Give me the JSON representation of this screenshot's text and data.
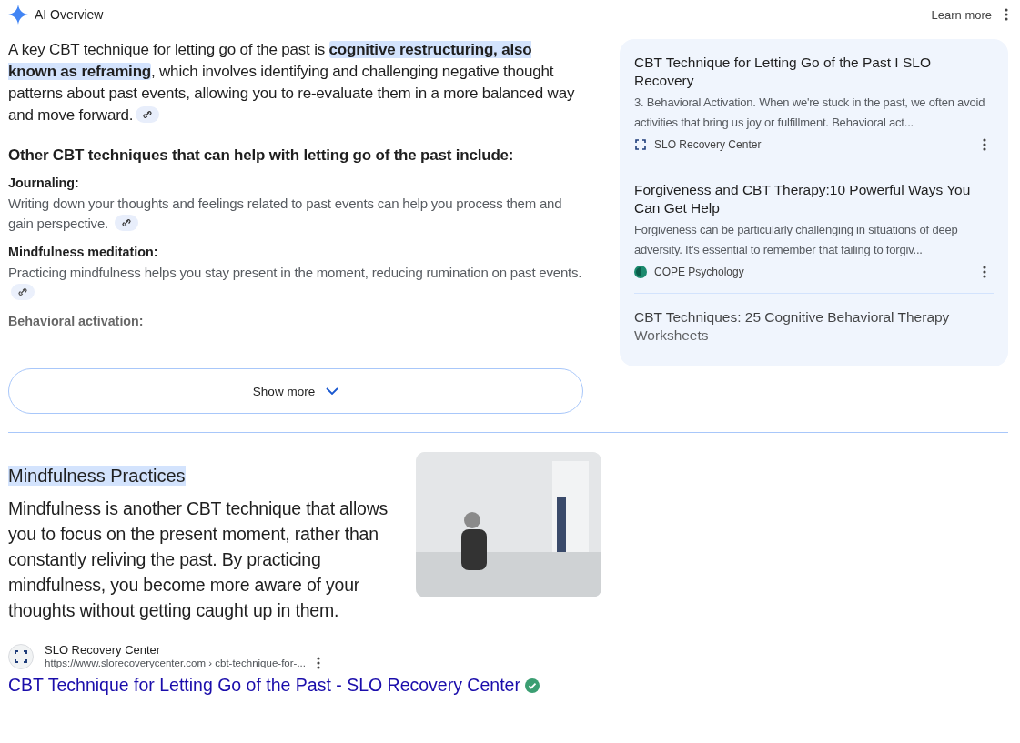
{
  "header": {
    "title": "AI Overview",
    "learn_more": "Learn more"
  },
  "overview": {
    "intro": [
      {
        "text": "A key CBT technique for letting go of the past is ",
        "highlighted": false
      },
      {
        "text": "cognitive restructuring, also known as reframing",
        "highlighted": true
      },
      {
        "text": ", which involves identifying and challenging negative thought patterns about past events, allowing you to re-evaluate them in a more balanced way and move forward.",
        "highlighted": false
      }
    ],
    "subheading": "Other CBT techniques that can help with letting go of the past include:",
    "techniques": [
      {
        "title": "Journaling:",
        "text": "Writing down your thoughts and feelings related to past events can help you process them and gain perspective."
      },
      {
        "title": "Mindfulness meditation:",
        "text": "Practicing mindfulness helps you stay present in the moment, reducing rumination on past events."
      },
      {
        "title": "Behavioral activation:"
      }
    ],
    "show_more": "Show more"
  },
  "sources": [
    {
      "title": "CBT Technique for Letting Go of the Past I SLO Recovery",
      "snippet": "3. Behavioral Activation. When we're stuck in the past, we often avoid activities that bring us joy or fulfillment. Behavioral act...",
      "site": "SLO Recovery Center",
      "kind": "brackets"
    },
    {
      "title": "Forgiveness and CBT Therapy:10 Powerful Ways You Can Get Help",
      "snippet": "Forgiveness can be particularly challenging in situations of deep adversity. It's essential to remember that failing to forgiv...",
      "site": "COPE Psychology",
      "kind": "circle"
    },
    {
      "title": "CBT Techniques: 25 Cognitive Behavioral Therapy Worksheets"
    }
  ],
  "featured": {
    "heading": "Mindfulness Practices",
    "highlighted": true,
    "text": "Mindfulness is another CBT technique that allows you to focus on the present moment, rather than constantly reliving the past. By practicing mindfulness, you become more aware of your thoughts without getting caught up in them.",
    "site": "SLO Recovery Center",
    "url": "https://www.slorecoverycenter.com › cbt-technique-for-...",
    "link": "CBT Technique for Letting Go of the Past - SLO Recovery Center",
    "verified": true
  }
}
